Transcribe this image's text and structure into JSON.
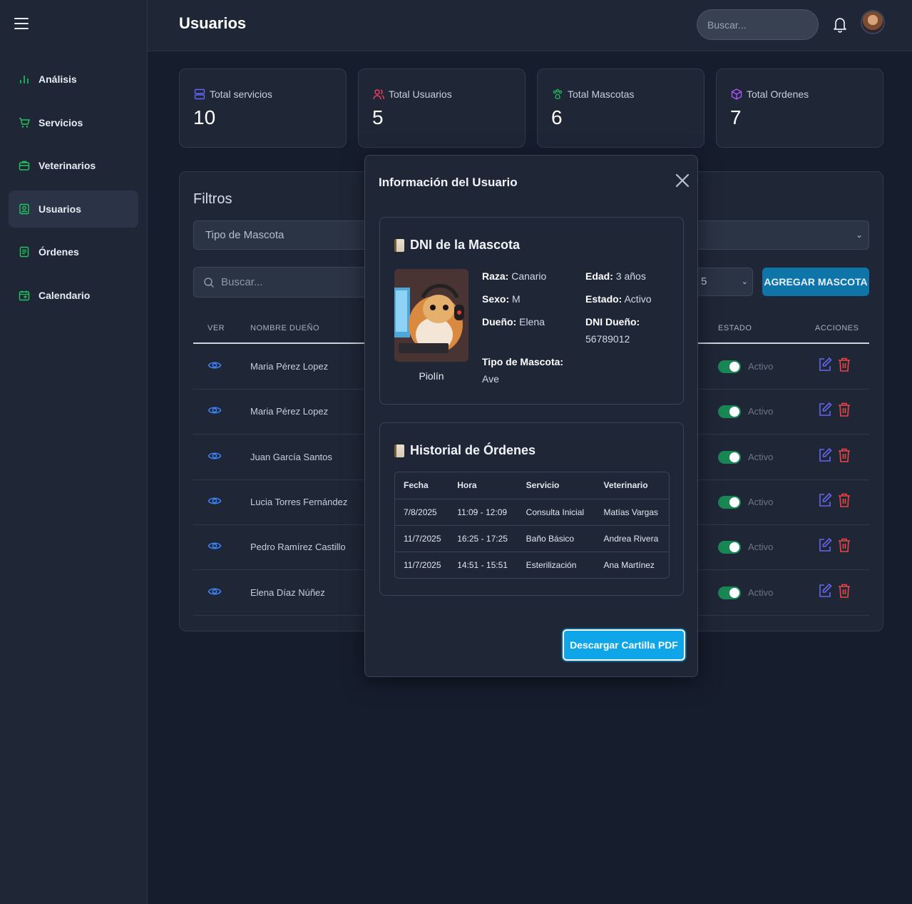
{
  "sidebar": {
    "items": [
      {
        "label": "Análisis",
        "icon": "bar-chart-icon"
      },
      {
        "label": "Servicios",
        "icon": "cart-icon"
      },
      {
        "label": "Veterinarios",
        "icon": "briefcase-medical-icon"
      },
      {
        "label": "Usuarios",
        "icon": "user-badge-icon",
        "active": true
      },
      {
        "label": "Órdenes",
        "icon": "clipboard-icon"
      },
      {
        "label": "Calendario",
        "icon": "calendar-icon"
      }
    ]
  },
  "header": {
    "title": "Usuarios",
    "search_placeholder": "Buscar..."
  },
  "stats": [
    {
      "label": "Total servicios",
      "value": "10",
      "icon": "server-icon",
      "color": "#6366f1"
    },
    {
      "label": "Total Usuarios",
      "value": "5",
      "icon": "users-icon",
      "color": "#f43f5e"
    },
    {
      "label": "Total Mascotas",
      "value": "6",
      "icon": "paw-icon",
      "color": "#22c55e"
    },
    {
      "label": "Total Ordenes",
      "value": "7",
      "icon": "package-icon",
      "color": "#a855f7"
    }
  ],
  "filters": {
    "title": "Filtros",
    "pet_type_placeholder": "Tipo de Mascota",
    "search_placeholder": "Buscar...",
    "page_size": "5",
    "add_button": "AGREGAR MASCOTA"
  },
  "table": {
    "headers": {
      "ver": "VER",
      "owner": "NOMBRE DUEÑO",
      "status": "ESTADO",
      "actions": "ACCIONES"
    },
    "rows": [
      {
        "owner": "Maria Pérez Lopez",
        "status": "Activo"
      },
      {
        "owner": "Maria Pérez Lopez",
        "status": "Activo"
      },
      {
        "owner": "Juan García Santos",
        "status": "Activo"
      },
      {
        "owner": "Lucia Torres Fernández",
        "status": "Activo"
      },
      {
        "owner": "Pedro Ramírez Castillo",
        "status": "Activo"
      },
      {
        "owner": "Elena Díaz Núñez",
        "status": "Activo"
      }
    ]
  },
  "modal": {
    "title": "Información del Usuario",
    "dni": {
      "title": "DNI de la Mascota",
      "pet_name": "Piolín",
      "raza_label": "Raza:",
      "raza": "Canario",
      "edad_label": "Edad:",
      "edad": "3 años",
      "sexo_label": "Sexo:",
      "sexo": "M",
      "estado_label": "Estado:",
      "estado": "Activo",
      "dueno_label": "Dueño:",
      "dueno": "Elena",
      "dni_dueno_label": "DNI Dueño:",
      "dni_dueno": "56789012",
      "tipo_label": "Tipo de Mascota:",
      "tipo": "Ave"
    },
    "orders": {
      "title": "Historial de Órdenes",
      "headers": [
        "Fecha",
        "Hora",
        "Servicio",
        "Veterinario"
      ],
      "rows": [
        [
          "7/8/2025",
          "11:09 - 12:09",
          "Consulta Inicial",
          "Matías Vargas"
        ],
        [
          "11/7/2025",
          "16:25 - 17:25",
          "Baño Básico",
          "Andrea Rivera"
        ],
        [
          "11/7/2025",
          "14:51 - 15:51",
          "Esterilización",
          "Ana Martínez"
        ]
      ]
    },
    "pdf_button": "Descargar Cartilla PDF"
  }
}
